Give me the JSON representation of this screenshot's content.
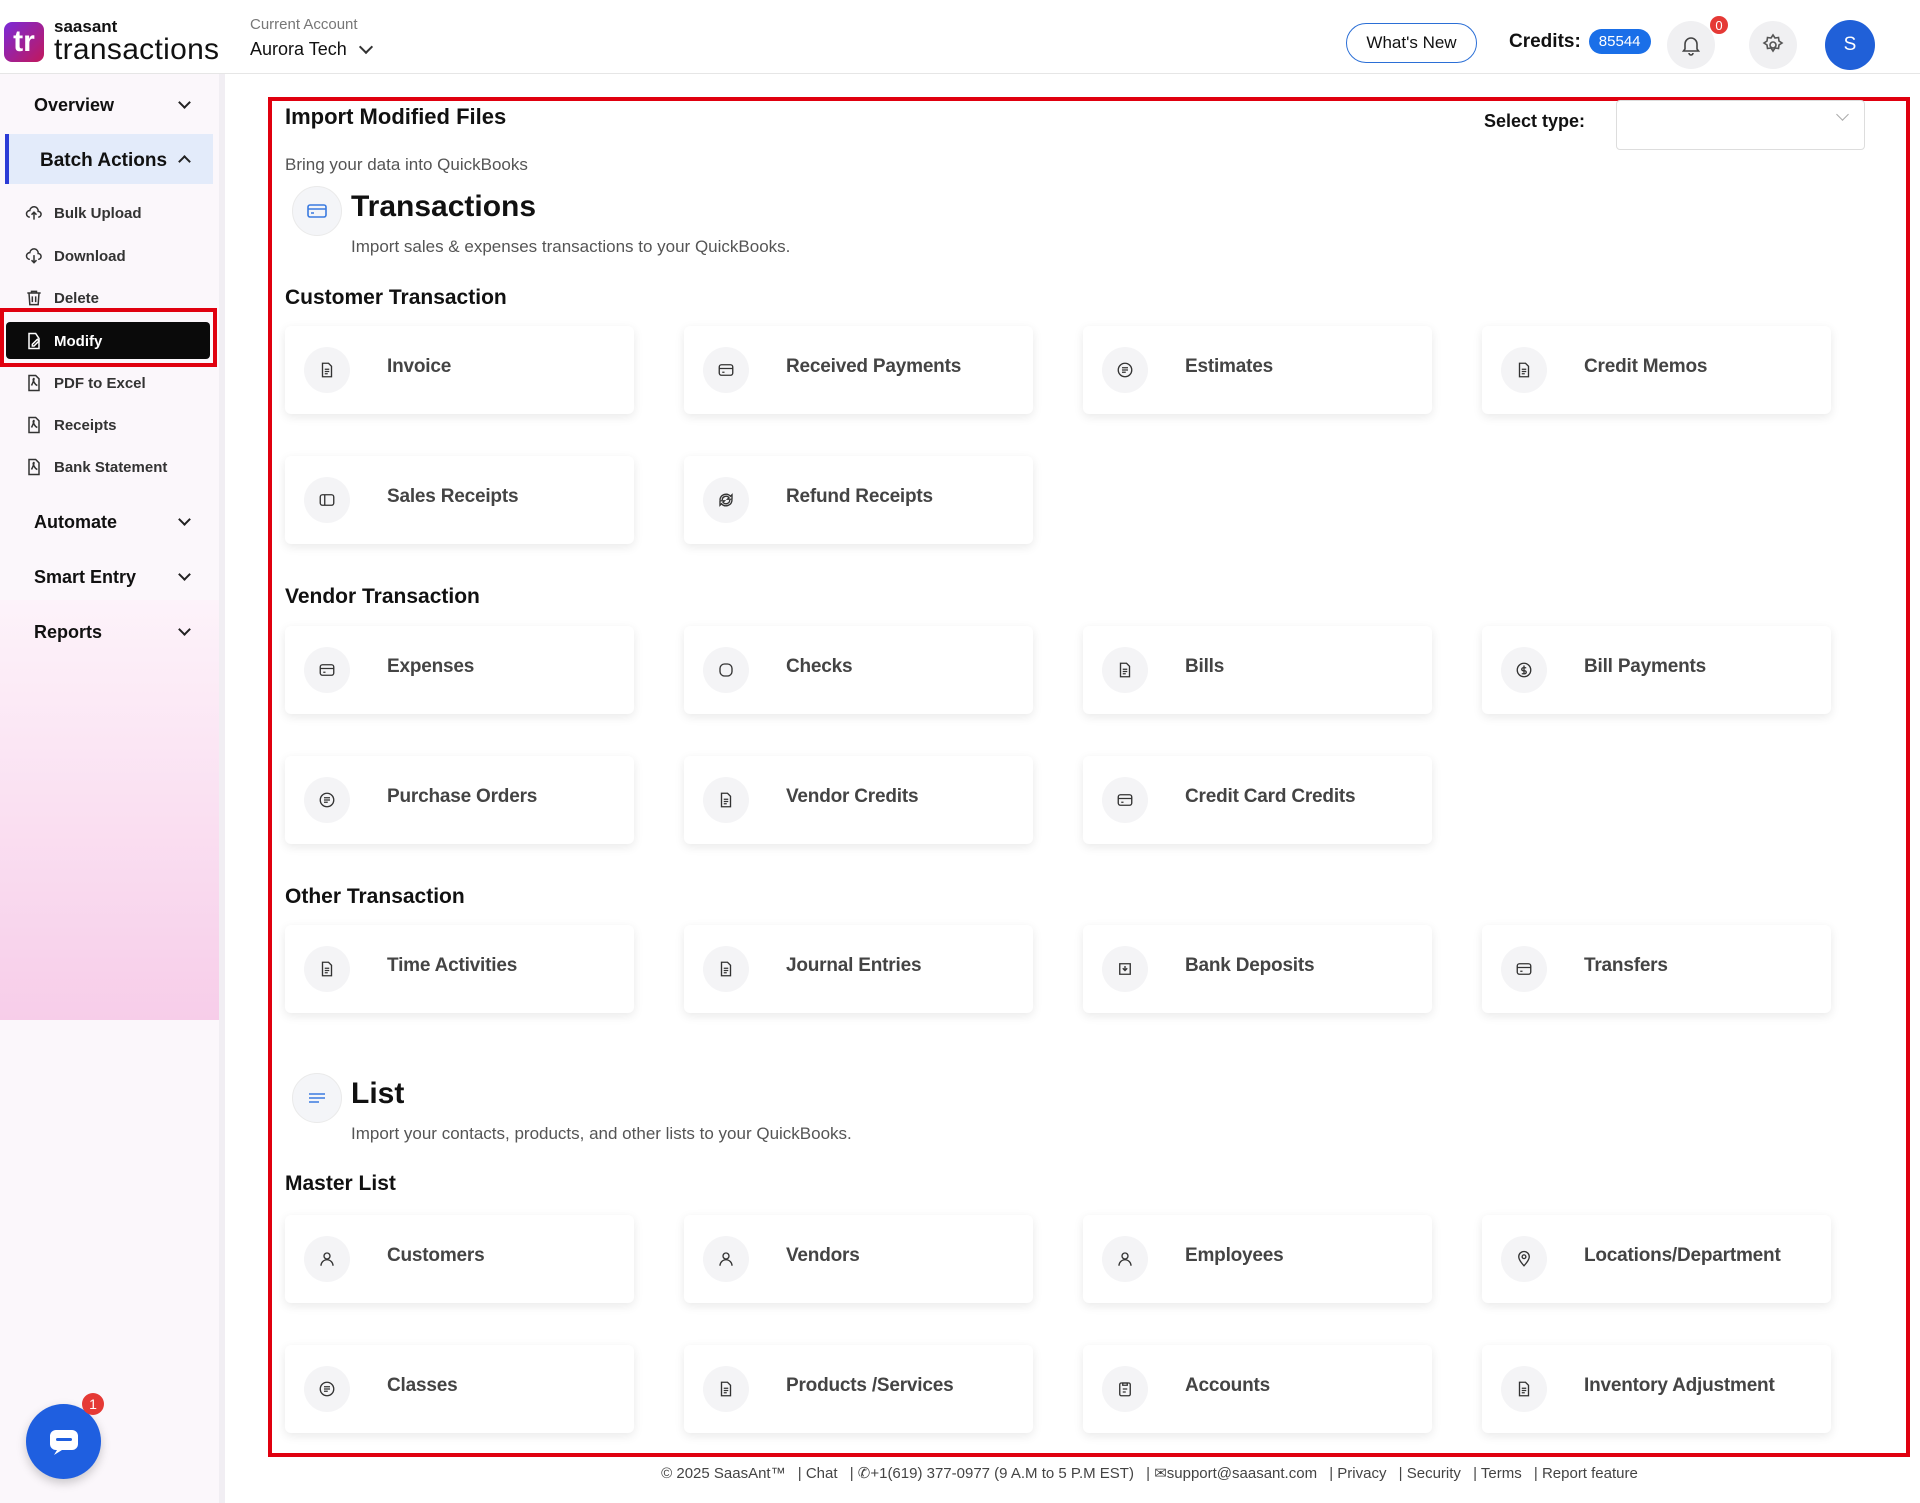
{
  "header": {
    "logo_small": "saasant",
    "logo_big": "transactions",
    "logo_mark": "tr",
    "account_label": "Current Account",
    "account_name": "Aurora Tech",
    "whats_new": "What's New",
    "credits_label": "Credits:",
    "credits_value": "85544",
    "notification_count": "0",
    "avatar_initial": "S"
  },
  "sidebar": {
    "overview": "Overview",
    "batch_actions": "Batch Actions",
    "items": {
      "bulk_upload": "Bulk Upload",
      "download": "Download",
      "delete": "Delete",
      "modify": "Modify",
      "pdf_to_excel": "PDF to Excel",
      "receipts": "Receipts",
      "bank_statement": "Bank Statement"
    },
    "automate": "Automate",
    "smart_entry": "Smart Entry",
    "reports": "Reports",
    "chat_badge": "1"
  },
  "main": {
    "title": "Import Modified Files",
    "subtitle": "Bring your data into QuickBooks",
    "select_type_label": "Select type:",
    "transactions": {
      "title": "Transactions",
      "desc": "Import sales & expenses transactions to your QuickBooks.",
      "customer": {
        "title": "Customer Transaction",
        "cards": [
          "Invoice",
          "Received Payments",
          "Estimates",
          "Credit Memos",
          "Sales Receipts",
          "Refund Receipts"
        ]
      },
      "vendor": {
        "title": "Vendor Transaction",
        "cards": [
          "Expenses",
          "Checks",
          "Bills",
          "Bill Payments",
          "Purchase Orders",
          "Vendor Credits",
          "Credit Card Credits"
        ]
      },
      "other": {
        "title": "Other Transaction",
        "cards": [
          "Time Activities",
          "Journal Entries",
          "Bank Deposits",
          "Transfers"
        ]
      }
    },
    "list": {
      "title": "List",
      "desc": "Import your contacts, products, and other lists to your QuickBooks.",
      "master": {
        "title": "Master List",
        "cards": [
          "Customers",
          "Vendors",
          "Employees",
          "Locations/Department",
          "Classes",
          "Products /Services",
          "Accounts",
          "Inventory Adjustment"
        ]
      }
    }
  },
  "footer": {
    "copyright": "© 2025 SaasAnt™",
    "chat": "| Chat",
    "phone": "| ✆+1(619) 377-0977 (9 A.M to 5 P.M EST)",
    "email": "| ✉support@saasant.com",
    "privacy": "| Privacy",
    "security": "| Security",
    "terms": "| Terms",
    "report": "| Report feature"
  },
  "colors": {
    "accent": "#1a6fe8",
    "highlight_frame": "#e0000f",
    "active_bg": "#e3ebfa"
  }
}
